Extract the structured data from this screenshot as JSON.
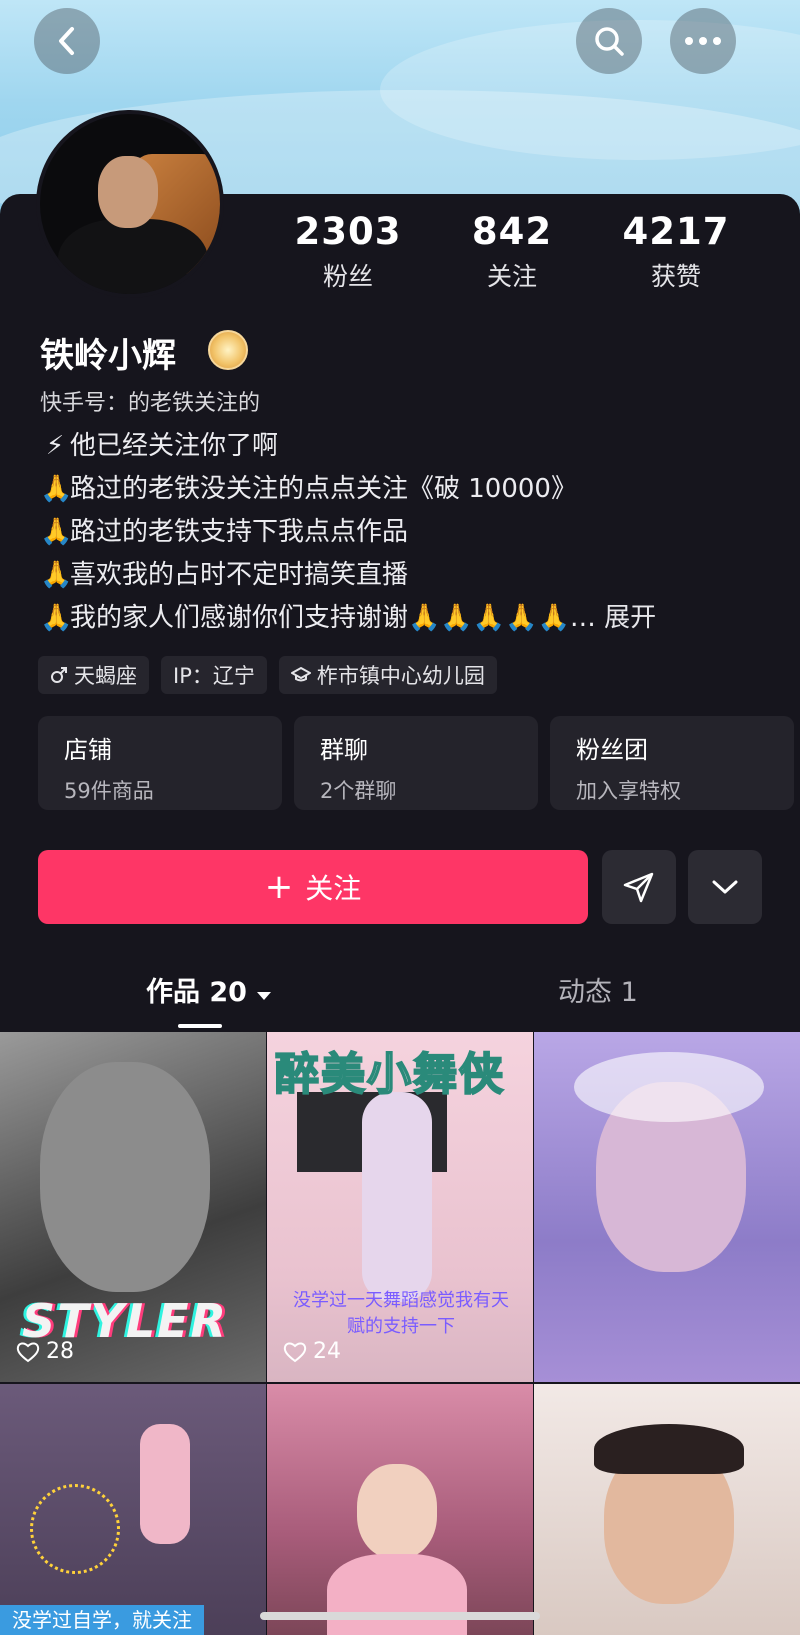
{
  "header": {
    "back_icon": "chevron-left-icon",
    "search_icon": "search-icon",
    "more_icon": "more-icon"
  },
  "profile": {
    "name": "铁岭小辉",
    "stats": [
      {
        "value": "2303",
        "label": "粉丝"
      },
      {
        "value": "842",
        "label": "关注"
      },
      {
        "value": "4217",
        "label": "获赞"
      }
    ],
    "bio": {
      "line1": "快手号：的老铁关注的",
      "line2": "他已经关注你了啊",
      "line3": "路过的老铁没关注的点点关注《破 10000》",
      "line4": "路过的老铁支持下我点点作品",
      "line5": "喜欢我的占时不定时搞笑直播",
      "line6": "我的家人们感谢你们支持谢谢",
      "ellipsis": "…",
      "expand": "展开"
    },
    "tags": [
      {
        "icon": "male-icon",
        "text": "天蝎座"
      },
      {
        "text": "IP：辽宁"
      },
      {
        "icon": "school-icon",
        "text": "柞市镇中心幼儿园"
      }
    ],
    "tiles": [
      {
        "title": "店铺",
        "sub": "59件商品"
      },
      {
        "title": "群聊",
        "sub": "2个群聊"
      },
      {
        "title": "粉丝团",
        "sub": "加入享特权"
      }
    ]
  },
  "actions": {
    "follow_plus": "+",
    "follow_label": "关注",
    "share_icon": "send-icon",
    "dropdown_icon": "chevron-down-icon"
  },
  "tabs": [
    {
      "label": "作品 20",
      "active": true
    },
    {
      "label": "动态 1",
      "active": false
    }
  ],
  "videos": [
    {
      "likes": "28",
      "overlay": "STYLER"
    },
    {
      "likes": "24",
      "title": "醉美小舞侠",
      "caption": "没学过一天舞蹈感觉我有天赋的支持一下"
    },
    {
      "likes": ""
    },
    {
      "caption": "没学过自学，就关注"
    },
    {},
    {}
  ],
  "colors": {
    "accent": "#fe3666",
    "background": "#16151d",
    "tile": "#24232b"
  }
}
